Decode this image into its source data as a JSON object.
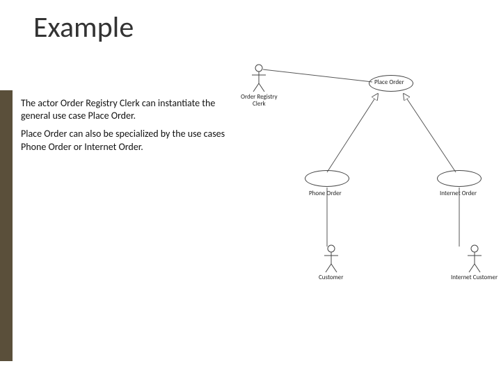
{
  "title": "Example",
  "paragraphs": [
    "The actor Order Registry Clerk can instantiate the general use case Place Order.",
    "Place Order can also be specialized by the use cases Phone Order or Internet Order."
  ],
  "diagram": {
    "actors": {
      "clerk": "Order Registry\nClerk",
      "customer": "Customer",
      "internet_customer": "Internet Customer"
    },
    "usecases": {
      "place_order": "Place Order",
      "phone_order": "Phone Order",
      "internet_order": "Internet Order"
    }
  }
}
